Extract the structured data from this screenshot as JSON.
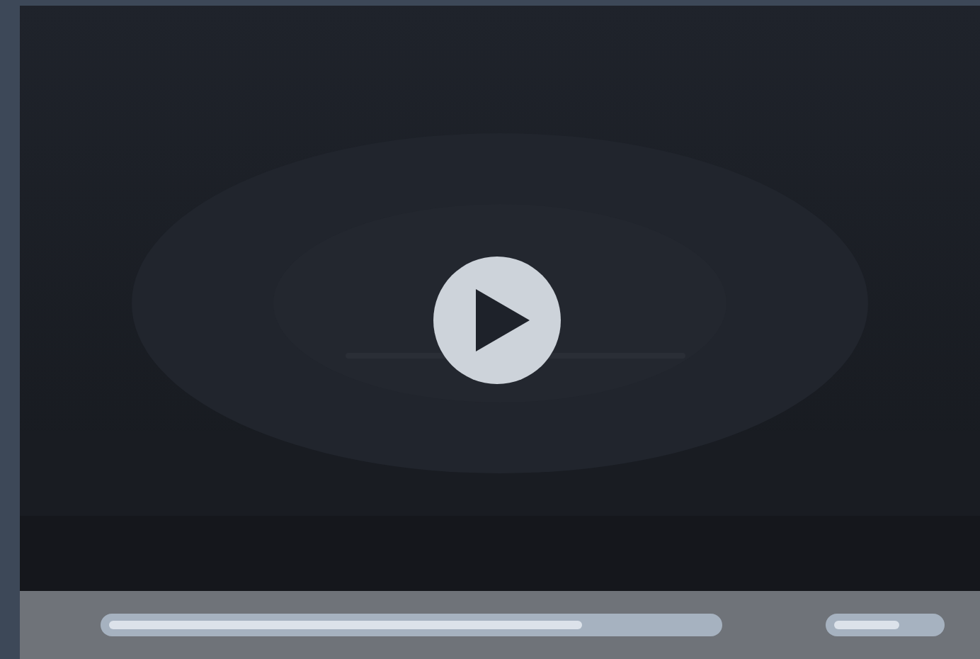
{
  "player": {
    "playing": false,
    "progress": {
      "level": 0.76
    },
    "volume": {
      "level": 0.55
    }
  }
}
